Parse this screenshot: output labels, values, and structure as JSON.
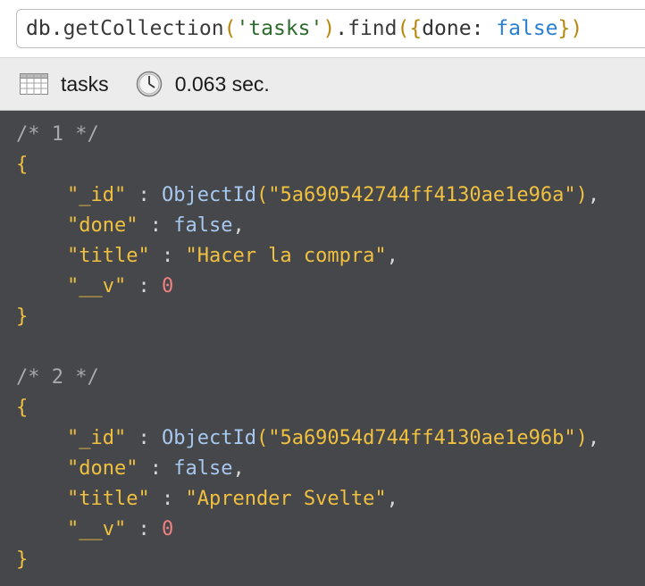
{
  "query": {
    "prefix": "db",
    "dot1": ".",
    "method1": "getCollection",
    "paren_open": "(",
    "collection_arg": "'tasks'",
    "paren_close": ")",
    "dot2": ".",
    "method2": "find",
    "find_open": "(",
    "brace_open": "{",
    "filter_key": "done",
    "filter_colon": ": ",
    "filter_value": "false",
    "brace_close": "}",
    "find_close": ")"
  },
  "status": {
    "collection": "tasks",
    "collection_icon": "table-icon",
    "time_icon": "clock-icon",
    "execution_time": "0.063 sec."
  },
  "results": [
    {
      "comment": "/* 1 */",
      "open": "{",
      "close": "}",
      "id_key": "\"_id\"",
      "id_func": "ObjectId",
      "id_value": "\"5a690542744ff4130ae1e96a\"",
      "done_key": "\"done\"",
      "done_value": "false",
      "title_key": "\"title\"",
      "title_value": "\"Hacer la compra\"",
      "v_key": "\"__v\"",
      "v_value": "0"
    },
    {
      "comment": "/* 2 */",
      "open": "{",
      "close": "}",
      "id_key": "\"_id\"",
      "id_func": "ObjectId",
      "id_value": "\"5a69054d744ff4130ae1e96b\"",
      "done_key": "\"done\"",
      "done_value": "false",
      "title_key": "\"title\"",
      "title_value": "\"Aprender Svelte\"",
      "v_key": "\"__v\"",
      "v_value": "0"
    }
  ],
  "colors": {
    "results_background": "#45474a",
    "key": "#f0c040",
    "comment": "#a7a9ab",
    "number": "#f08080"
  }
}
